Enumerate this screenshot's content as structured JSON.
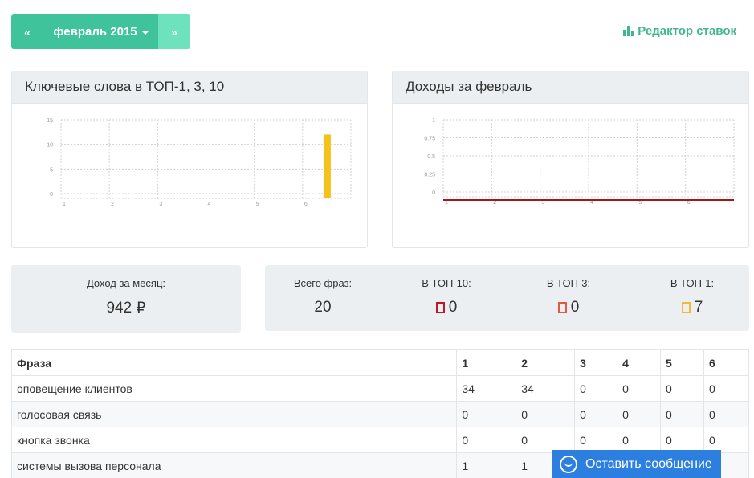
{
  "month_picker": {
    "prev_label": "«",
    "current_label": "февраль 2015",
    "next_label": "»"
  },
  "bid_editor_label": "Редактор ставок",
  "keywords_panel": {
    "title": "Ключевые слова в ТОП-1, 3, 10"
  },
  "income_panel": {
    "title": "Доходы за февраль"
  },
  "chart_data": [
    {
      "type": "bar",
      "x": [
        1,
        2,
        3,
        4,
        5,
        6
      ],
      "x_ticks": [
        "1",
        "2",
        "3",
        "4",
        "5",
        "6"
      ],
      "y_ticks": [
        "0",
        "5",
        "10",
        "15"
      ],
      "ylim": [
        0,
        15
      ],
      "series": [
        {
          "values": [
            0,
            0,
            0,
            0,
            0,
            12
          ],
          "color": "#f5c21b"
        }
      ],
      "grid": true
    },
    {
      "type": "line",
      "x": [
        1,
        2,
        3,
        4,
        5,
        6
      ],
      "x_ticks": [
        "1",
        "2",
        "3",
        "4",
        "5",
        "6"
      ],
      "y_ticks": [
        "0",
        "0.25",
        "0.5",
        "0.75",
        "1"
      ],
      "ylim": [
        0,
        1
      ],
      "series": [
        {
          "values": [
            0,
            0,
            0,
            0,
            0,
            0
          ],
          "color": "#a8151b"
        }
      ],
      "grid": true
    }
  ],
  "monthly_income": {
    "label": "Доход за месяц:",
    "value": "942 ₽"
  },
  "phrases": {
    "total_label": "Всего фраз:",
    "total_value": "20",
    "top10_label": "В ТОП-10:",
    "top10_value": "0",
    "top10_color": "#c0152b",
    "top3_label": "В ТОП-3:",
    "top3_value": "0",
    "top3_color": "#e8573f",
    "top1_label": "В ТОП-1:",
    "top1_value": "7",
    "top1_color": "#f0b93a"
  },
  "table": {
    "headers": [
      "Фраза",
      "1",
      "2",
      "3",
      "4",
      "5",
      "6"
    ],
    "rows": [
      [
        "оповещение клиентов",
        "34",
        "34",
        "0",
        "0",
        "0",
        "0"
      ],
      [
        "голосовая связь",
        "0",
        "0",
        "0",
        "0",
        "0",
        "0"
      ],
      [
        "кнопка звонка",
        "0",
        "0",
        "0",
        "0",
        "0",
        "0"
      ],
      [
        "системы вызова персонала",
        "1",
        "1",
        "",
        "",
        "",
        ""
      ]
    ]
  },
  "chat_button_label": "Оставить сообщение"
}
